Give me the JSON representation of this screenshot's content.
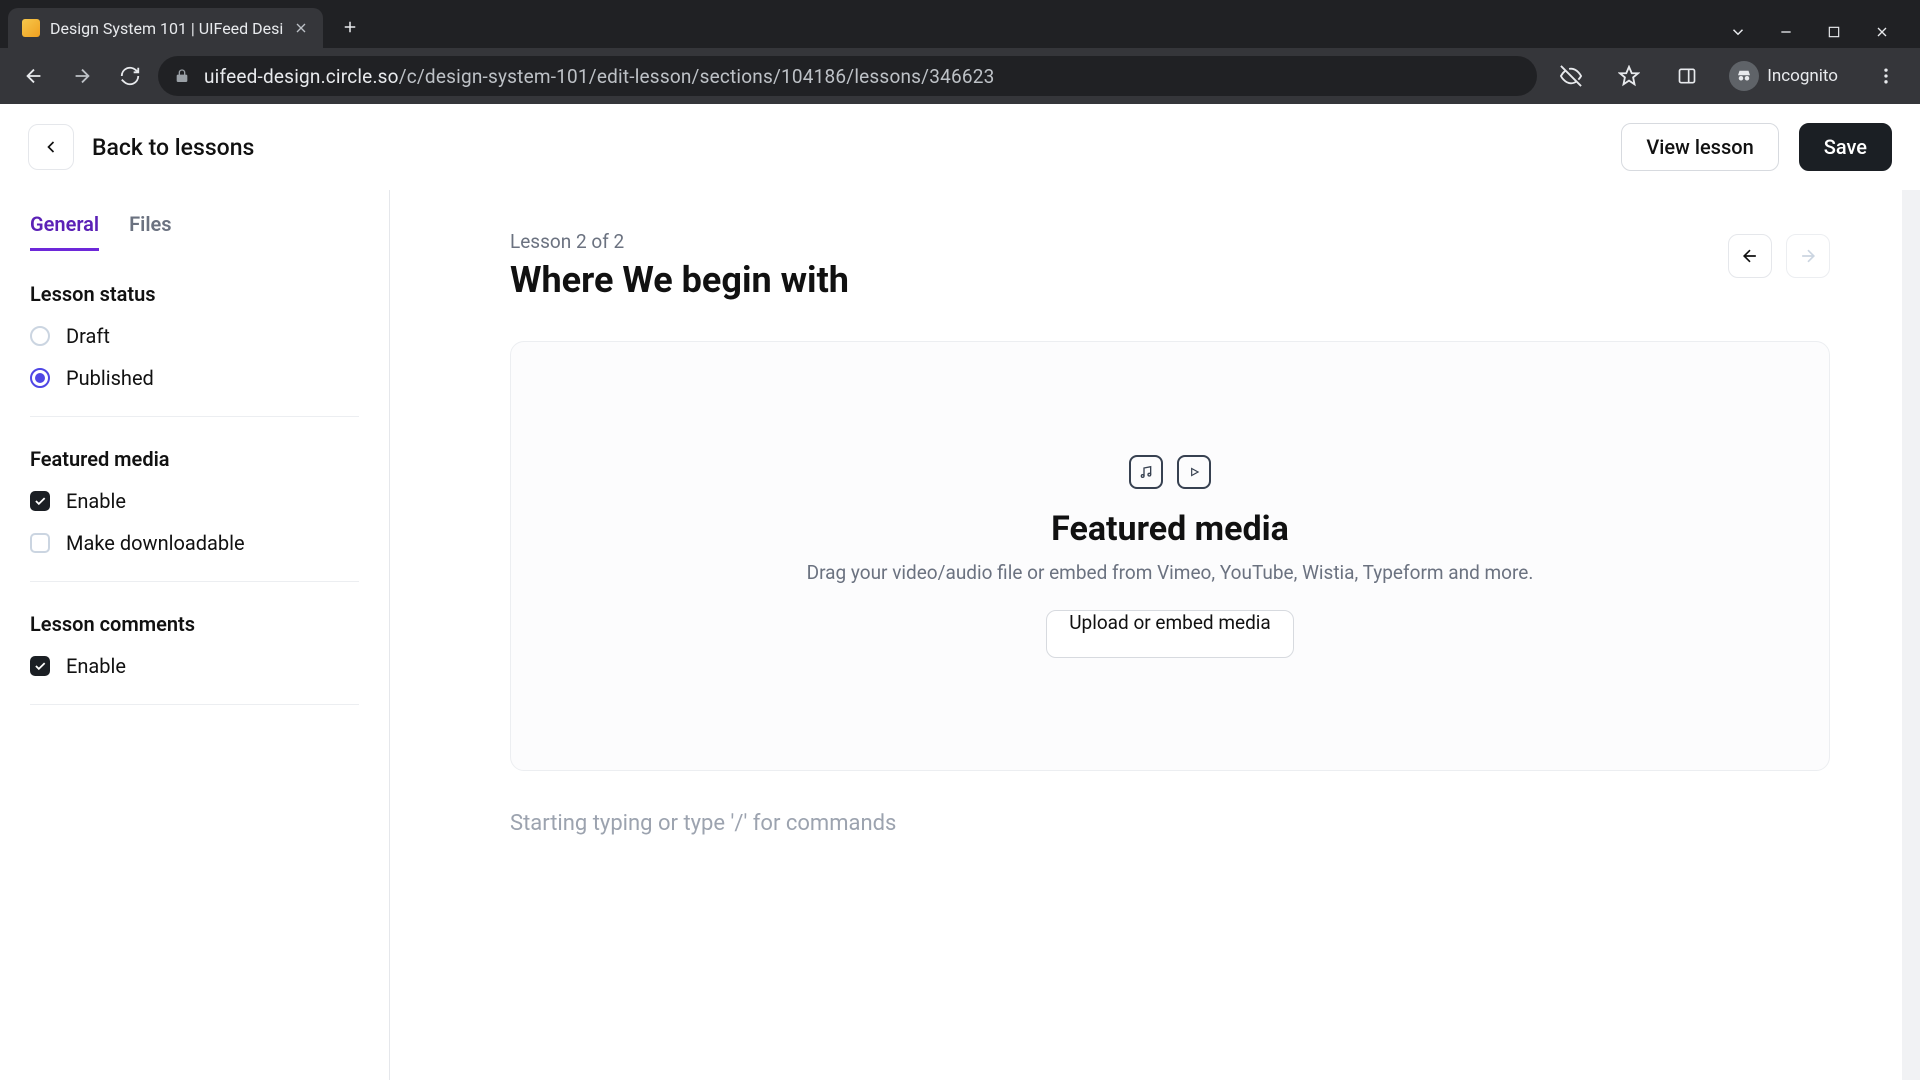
{
  "browser": {
    "tab_title": "Design System 101 | UIFeed Desi",
    "url_host": "uifeed-design.circle.so",
    "url_path": "/c/design-system-101/edit-lesson/sections/104186/lessons/346623",
    "incognito_label": "Incognito"
  },
  "header": {
    "back_label": "Back to lessons",
    "view_lesson": "View lesson",
    "save": "Save"
  },
  "sidebar": {
    "tabs": {
      "general": "General",
      "files": "Files"
    },
    "status": {
      "title": "Lesson status",
      "draft": "Draft",
      "published": "Published"
    },
    "featured": {
      "title": "Featured media",
      "enable": "Enable",
      "downloadable": "Make downloadable"
    },
    "comments": {
      "title": "Lesson comments",
      "enable": "Enable"
    }
  },
  "main": {
    "meta": "Lesson 2 of 2",
    "title": "Where We begin with",
    "media_title": "Featured media",
    "media_sub": "Drag your video/audio file or embed from Vimeo, YouTube, Wistia, Typeform and more.",
    "upload_label": "Upload or embed media",
    "editor_placeholder": "Starting typing or type '/' for commands"
  }
}
